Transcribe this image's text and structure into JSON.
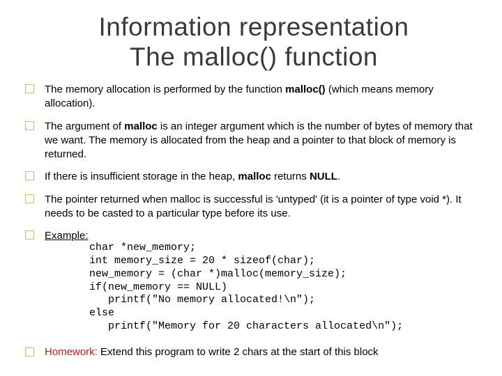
{
  "title_line1": "Information representation",
  "title_line2": "The malloc() function",
  "bullets": [
    {
      "prefix": "The memory allocation is performed by the function ",
      "bold1": "malloc()",
      "rest": " (which means memory allocation)."
    },
    {
      "prefix": "The argument of ",
      "bold1": "malloc",
      "mid": " is an integer argument which is the number of bytes of memory that we want.  The memory is allocated from the heap and a pointer to that block of memory is returned."
    },
    {
      "prefix": "If there is insufficient storage in the heap, ",
      "bold1": "malloc",
      "mid": " returns ",
      "bold2": "NULL",
      "rest": "."
    },
    {
      "prefix": "The pointer returned when malloc is successful is 'untyped' (it is a pointer of type void *).  It needs to be casted to a particular type before its use."
    }
  ],
  "example_label": "Example:",
  "code_lines": [
    "char *new_memory;",
    "int memory_size = 20 * sizeof(char);",
    "new_memory = (char *)malloc(memory_size);",
    "if(new_memory == NULL)",
    "   printf(\"No memory allocated!\\n\");",
    "else",
    "   printf(\"Memory for 20 characters allocated\\n\");"
  ],
  "homework_label": "Homework:",
  "homework_rest": " Extend this program to write 2 chars at the start of this block"
}
